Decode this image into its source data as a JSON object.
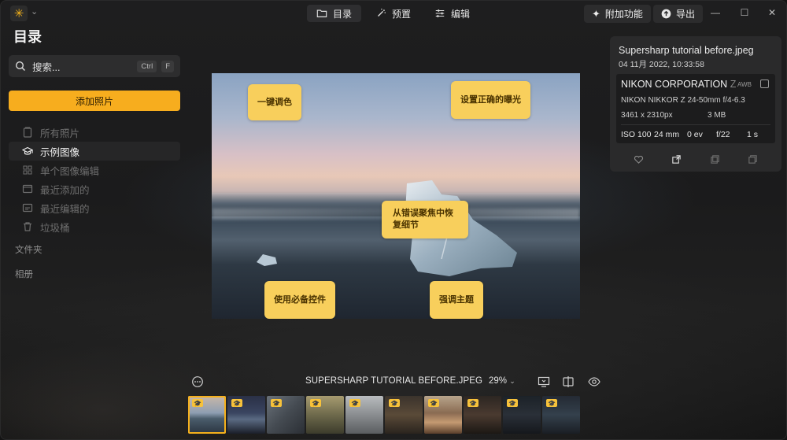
{
  "app": {
    "title": "目录",
    "tabs": [
      {
        "label": "目录",
        "icon": "folder-icon",
        "active": true
      },
      {
        "label": "预置",
        "icon": "wand-icon",
        "active": false
      },
      {
        "label": "编辑",
        "icon": "sliders-icon",
        "active": false
      }
    ],
    "addons_label": "附加功能",
    "export_label": "导出",
    "accent_color": "#f7ad1e"
  },
  "sidebar": {
    "search_placeholder": "搜索...",
    "shortcut_keys": [
      "Ctrl",
      "F"
    ],
    "add_photos_label": "添加照片",
    "items": [
      {
        "label": "所有照片",
        "icon": "photos-icon",
        "active": false
      },
      {
        "label": "示例图像",
        "icon": "graduation-cap-icon",
        "active": true
      },
      {
        "label": "单个图像编辑",
        "icon": "grid-icon",
        "active": false
      },
      {
        "label": "最近添加的",
        "icon": "recent-added-icon",
        "active": false
      },
      {
        "label": "最近编辑的",
        "icon": "recent-edited-icon",
        "active": false
      },
      {
        "label": "垃圾桶",
        "icon": "trash-icon",
        "active": false
      }
    ],
    "sections": {
      "folders": "文件夹",
      "albums": "相册"
    }
  },
  "photo": {
    "tips": [
      {
        "label": "一键调色"
      },
      {
        "label": "设置正确的曝光"
      },
      {
        "label": "从错误聚焦中恢复细节"
      },
      {
        "label": "使用必备控件"
      },
      {
        "label": "强调主题"
      }
    ]
  },
  "info": {
    "filename": "Supersharp tutorial before.jpeg",
    "date": "04 11月 2022, 10:33:58",
    "camera": "NIKON CORPORATION",
    "camera_suffix": "Z",
    "awb": "AWB",
    "lens": "NIKON NIKKOR Z 24-50mm f/4-6.3",
    "dimensions": "3461 x 2310px",
    "filesize": "3 MB",
    "iso": "ISO 100",
    "focal": "24 mm",
    "ev": "0 ev",
    "aperture": "f/22",
    "shutter": "1 s"
  },
  "viewer": {
    "filename_caps": "SUPERSHARP TUTORIAL BEFORE.JPEG",
    "zoom": "29%"
  },
  "filmstrip": {
    "count": 10,
    "selected_index": 0
  }
}
